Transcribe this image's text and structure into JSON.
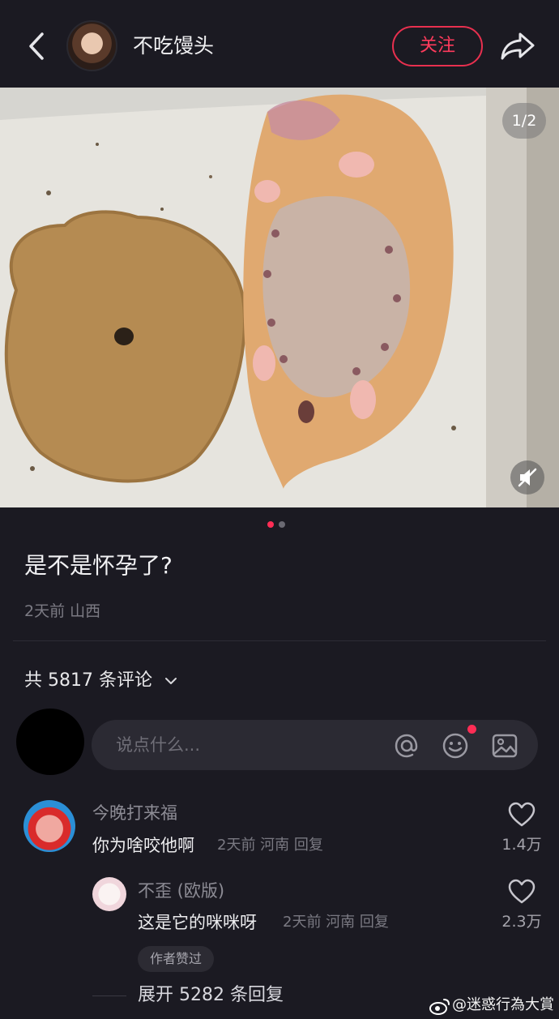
{
  "header": {
    "author_name": "不吃馒头",
    "follow_label": "关注"
  },
  "photo": {
    "counter": "1/2",
    "page_index": 1,
    "page_total": 2
  },
  "post": {
    "title": "是不是怀孕了?",
    "meta": "2天前 山西"
  },
  "comments": {
    "count_label": "共 5817 条评论",
    "input_placeholder": "说点什么...",
    "items": [
      {
        "user": "今晚打来福",
        "text": "你为啥咬他啊",
        "meta": "2天前 河南 回复",
        "likes": "1.4万"
      },
      {
        "user": "不歪 (欧版)",
        "text": "这是它的咪咪呀",
        "meta": "2天前 河南 回复",
        "likes": "2.3万",
        "badge": "作者赞过"
      }
    ],
    "expand_label": "展开 5282 条回复"
  },
  "watermark": "@迷惑行為大賞",
  "colors": {
    "background": "#1b1a22",
    "accent": "#ff3b5c",
    "input_bg": "#2b2a33"
  },
  "icons": [
    "back-arrow-icon",
    "share-icon",
    "mute-icon",
    "chevron-down-icon",
    "at-icon",
    "emoji-icon",
    "image-icon",
    "heart-icon",
    "weibo-icon"
  ]
}
